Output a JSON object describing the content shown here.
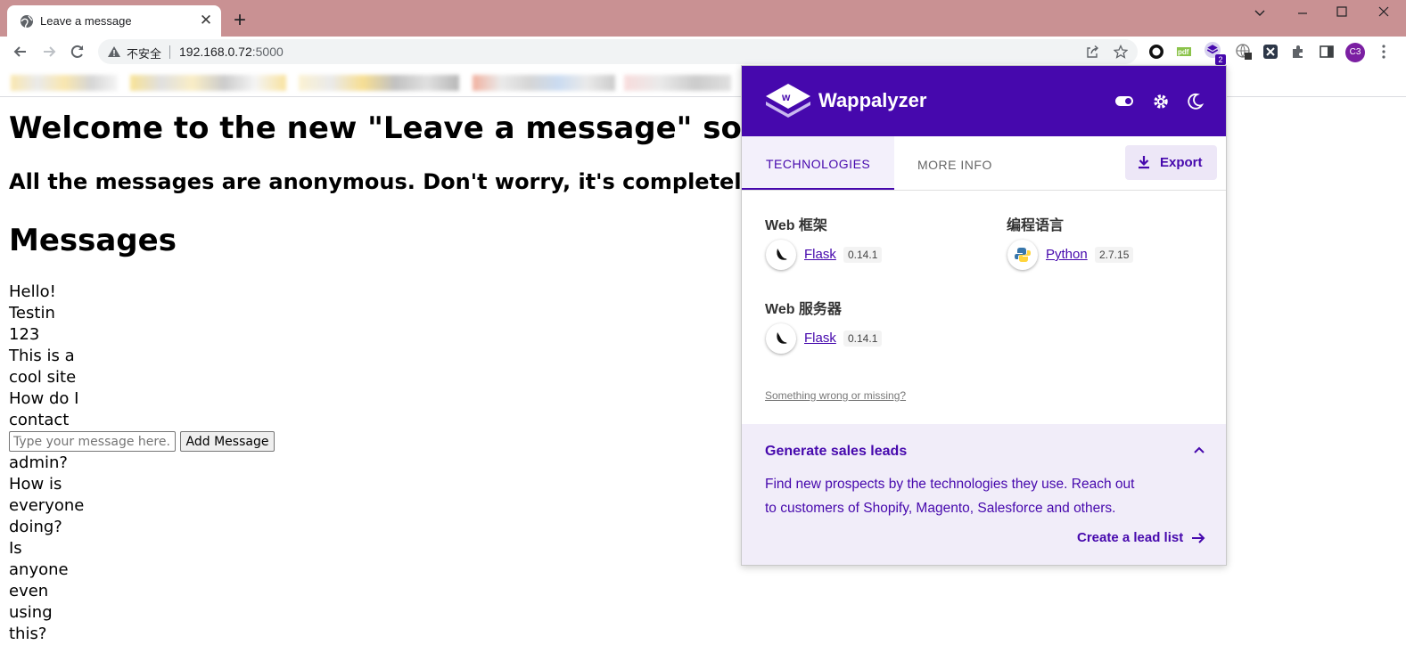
{
  "browser": {
    "tab_title": "Leave a message",
    "address": {
      "security_label": "不安全",
      "host": "192.168.0.72",
      "port": ":5000"
    },
    "profile_initials": "C3",
    "extension_badge": "2"
  },
  "page": {
    "heading": "Welcome to the new \"Leave a message\" social",
    "subheading": "All the messages are anonymous. Don't worry, it's completely",
    "messages_heading": "Messages",
    "messages": [
      "Hello!",
      "Testin 123",
      "This is a cool site",
      "How do I contact the admin?",
      "How is everyone doing?",
      "Is anyone even using this?"
    ],
    "input_placeholder": "Type your message here...",
    "add_button": "Add Message"
  },
  "wappalyzer": {
    "brand": "Wappalyzer",
    "tabs": {
      "technologies": "TECHNOLOGIES",
      "more_info": "MORE INFO"
    },
    "export_label": "Export",
    "categories": [
      {
        "name": "Web 框架",
        "tech": "Flask",
        "version": "0.14.1"
      },
      {
        "name": "编程语言",
        "tech": "Python",
        "version": "2.7.15"
      },
      {
        "name": "Web 服务器",
        "tech": "Flask",
        "version": "0.14.1"
      }
    ],
    "wrong_link": "Something wrong or missing?",
    "leads": {
      "title": "Generate sales leads",
      "line1": "Find new prospects by the technologies they use. Reach out",
      "line2": "to customers of Shopify, Magento, Salesforce and others.",
      "link": "Create a lead list"
    },
    "accent": "#4608ad"
  }
}
